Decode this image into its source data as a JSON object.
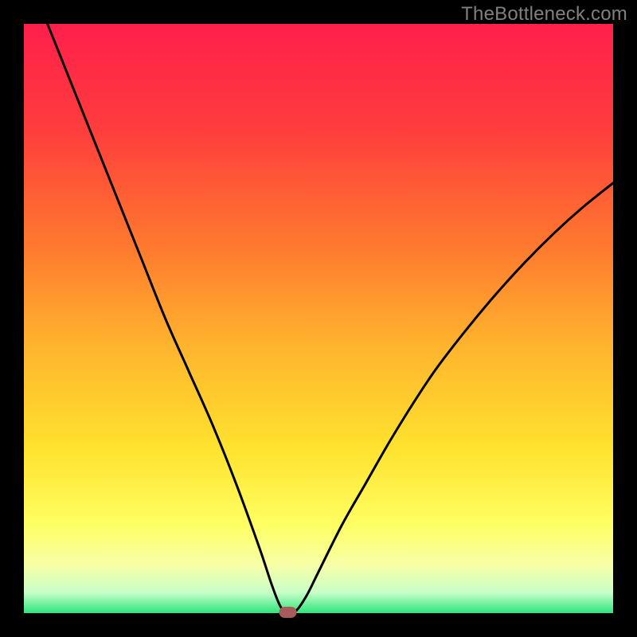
{
  "watermark": "TheBottleneck.com",
  "chart_data": {
    "type": "line",
    "title": "",
    "xlabel": "",
    "ylabel": "",
    "xlim": [
      0,
      100
    ],
    "ylim": [
      0,
      100
    ],
    "curve": {
      "description": "V-shaped bottleneck curve; left branch descends steeply from top-left toward a minimum near x≈45, right branch rises with a concave-up shape toward upper-right.",
      "minimum_x": 44.8,
      "minimum_y": 0.0,
      "points": [
        {
          "x": 4.0,
          "y": 100.0
        },
        {
          "x": 8.0,
          "y": 90.0
        },
        {
          "x": 12.0,
          "y": 80.0
        },
        {
          "x": 16.0,
          "y": 70.0
        },
        {
          "x": 20.0,
          "y": 60.0
        },
        {
          "x": 24.0,
          "y": 50.0
        },
        {
          "x": 28.0,
          "y": 41.0
        },
        {
          "x": 32.0,
          "y": 32.0
        },
        {
          "x": 36.0,
          "y": 22.0
        },
        {
          "x": 40.0,
          "y": 11.0
        },
        {
          "x": 42.0,
          "y": 5.0
        },
        {
          "x": 43.5,
          "y": 1.2
        },
        {
          "x": 44.8,
          "y": 0.0
        },
        {
          "x": 46.2,
          "y": 0.4
        },
        {
          "x": 48.0,
          "y": 3.0
        },
        {
          "x": 50.0,
          "y": 7.0
        },
        {
          "x": 54.0,
          "y": 15.0
        },
        {
          "x": 58.0,
          "y": 22.0
        },
        {
          "x": 62.0,
          "y": 29.0
        },
        {
          "x": 66.0,
          "y": 35.5
        },
        {
          "x": 70.0,
          "y": 41.5
        },
        {
          "x": 75.0,
          "y": 48.0
        },
        {
          "x": 80.0,
          "y": 54.0
        },
        {
          "x": 85.0,
          "y": 59.5
        },
        {
          "x": 90.0,
          "y": 64.5
        },
        {
          "x": 95.0,
          "y": 69.0
        },
        {
          "x": 100.0,
          "y": 73.0
        }
      ]
    },
    "marker": {
      "x": 44.8,
      "y": 0.0,
      "color": "#A95A5A",
      "shape": "rounded-rect"
    },
    "background_gradient": {
      "stops": [
        {
          "offset": 0.0,
          "color": "#FF1F4B"
        },
        {
          "offset": 0.18,
          "color": "#FF3D3D"
        },
        {
          "offset": 0.38,
          "color": "#FF7A2E"
        },
        {
          "offset": 0.55,
          "color": "#FFB52E"
        },
        {
          "offset": 0.72,
          "color": "#FFE22E"
        },
        {
          "offset": 0.85,
          "color": "#FFFF62"
        },
        {
          "offset": 0.92,
          "color": "#F6FFA8"
        },
        {
          "offset": 0.965,
          "color": "#C8FFC8"
        },
        {
          "offset": 1.0,
          "color": "#2EE57A"
        }
      ]
    },
    "border_color": "#000000",
    "border_width": 30
  }
}
